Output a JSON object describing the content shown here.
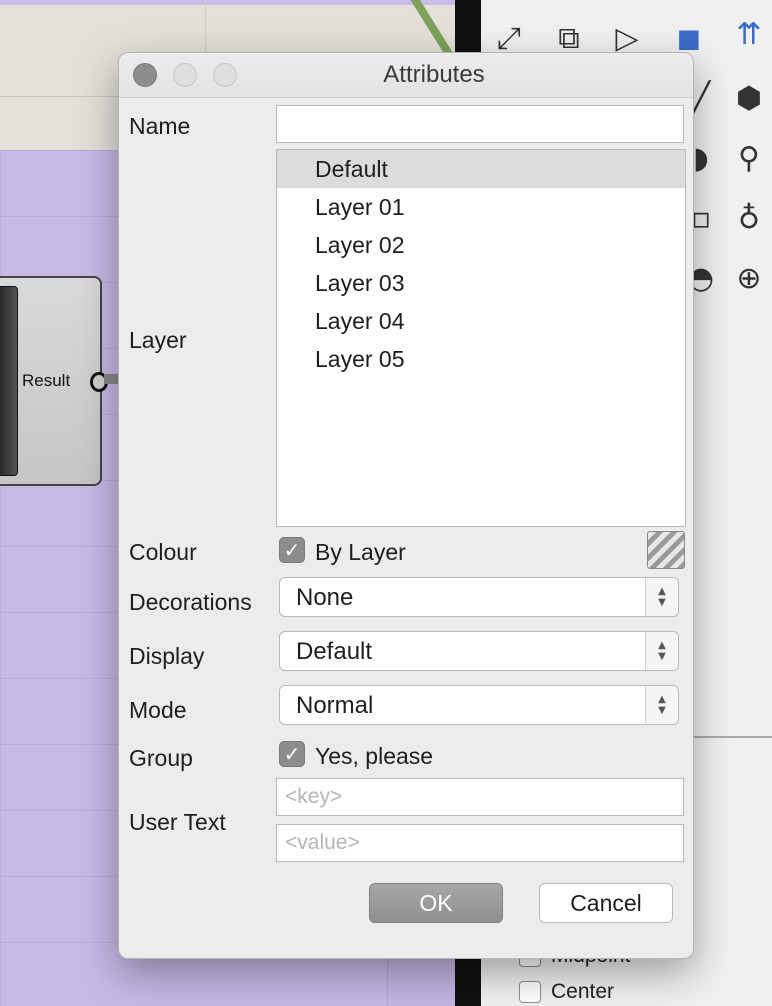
{
  "background": {
    "node_label": "Result",
    "snap_options": [
      {
        "label": "Midpoint",
        "checked": false
      },
      {
        "label": "Center",
        "checked": false
      }
    ]
  },
  "dialog": {
    "title": "Attributes",
    "name": {
      "label": "Name",
      "value": ""
    },
    "layer": {
      "label": "Layer",
      "items": [
        "Default",
        "Layer 01",
        "Layer 02",
        "Layer 03",
        "Layer 04",
        "Layer 05"
      ],
      "selected": "Default"
    },
    "colour": {
      "label": "Colour",
      "checkbox_label": "By Layer",
      "checked": true
    },
    "decorations": {
      "label": "Decorations",
      "value": "None"
    },
    "display": {
      "label": "Display",
      "value": "Default"
    },
    "mode": {
      "label": "Mode",
      "value": "Normal"
    },
    "group": {
      "label": "Group",
      "checkbox_label": "Yes, please",
      "checked": true
    },
    "user_text": {
      "label": "User Text",
      "key_placeholder": "<key>",
      "value_placeholder": "<value>"
    },
    "ok_label": "OK",
    "cancel_label": "Cancel"
  },
  "colors": {
    "canvas": "#c6b9e6",
    "dialog_bg": "#ececec",
    "checkbox": "#8d8d8d",
    "ok_button": "#9a9a9a"
  }
}
